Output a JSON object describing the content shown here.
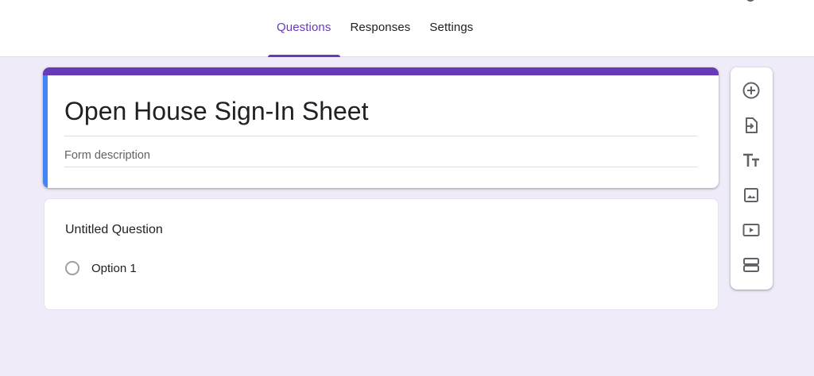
{
  "tabs": [
    {
      "label": "Questions",
      "active": true
    },
    {
      "label": "Responses",
      "active": false
    },
    {
      "label": "Settings",
      "active": false
    }
  ],
  "form": {
    "title": "Open House Sign-In Sheet",
    "description_placeholder": "Form description"
  },
  "question": {
    "title": "Untitled Question",
    "options": [
      "Option 1"
    ]
  },
  "toolbar": {
    "tools": [
      {
        "icon": "add-circle-icon"
      },
      {
        "icon": "import-questions-icon"
      },
      {
        "icon": "title-text-icon"
      },
      {
        "icon": "image-icon"
      },
      {
        "icon": "video-icon"
      },
      {
        "icon": "section-icon"
      }
    ]
  },
  "colors": {
    "accent": "#673ab7",
    "active_edge": "#4285f4",
    "background": "#f0ebf8",
    "icon": "#5f6368"
  }
}
